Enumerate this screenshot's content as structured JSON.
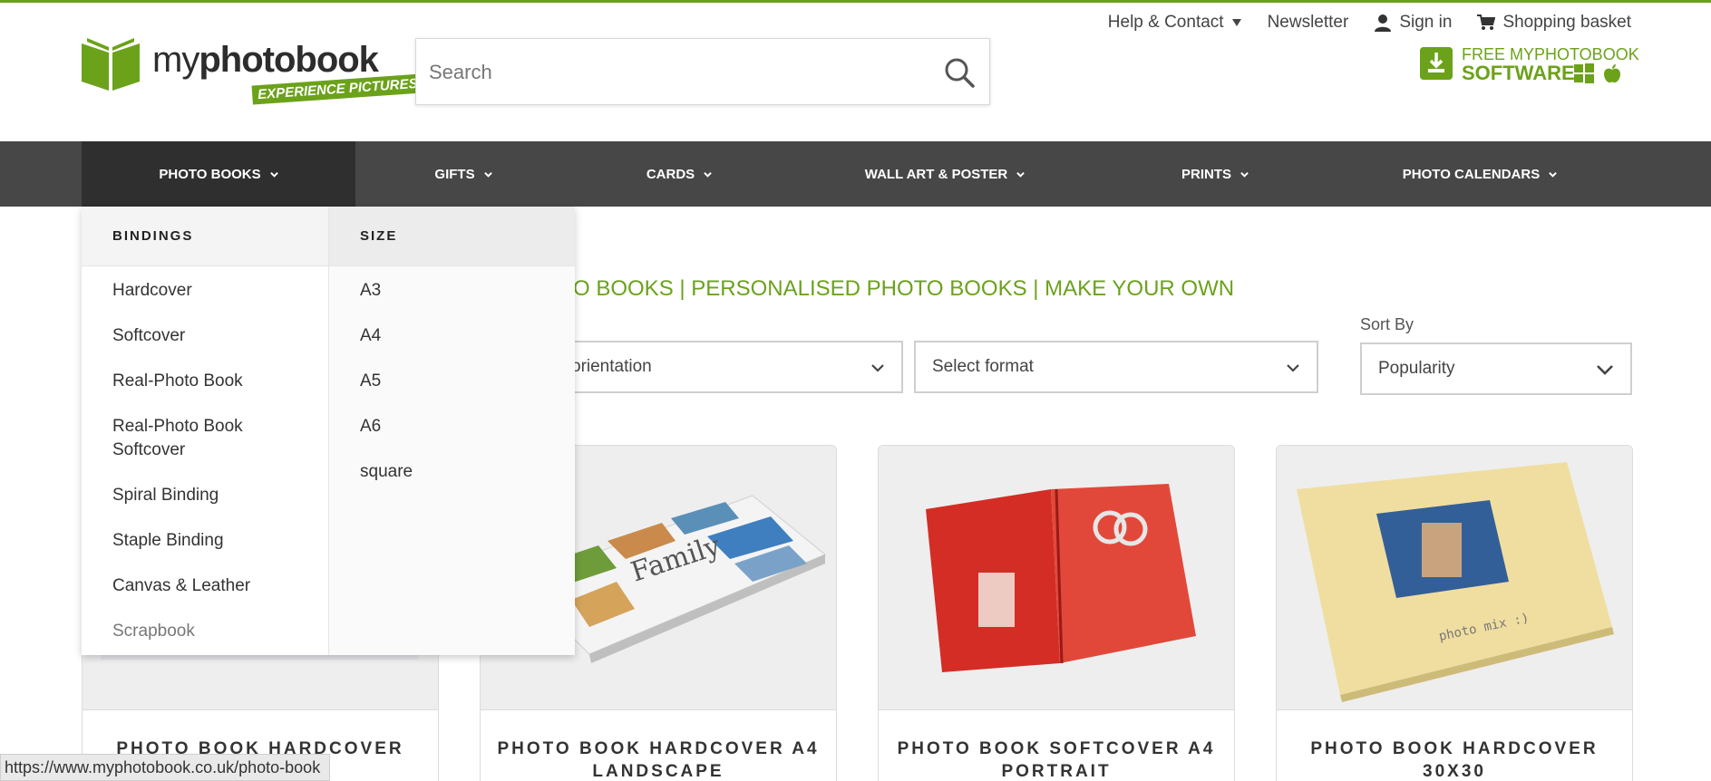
{
  "colors": {
    "brand_green": "#6ba21a",
    "nav_bg": "#474747",
    "nav_active": "#2f2f2f"
  },
  "logo": {
    "prefix": "my",
    "brand_bold": "photobook",
    "tagline": "EXPERIENCE PICTURES"
  },
  "search": {
    "placeholder": "Search"
  },
  "toplinks": {
    "help": "Help & Contact",
    "newsletter": "Newsletter",
    "signin": "Sign in",
    "basket": "Shopping basket"
  },
  "software": {
    "line1": "FREE MYPHOTOBOOK",
    "line2": "SOFTWARE"
  },
  "nav": {
    "items": [
      {
        "label": "PHOTO BOOKS"
      },
      {
        "label": "GIFTS"
      },
      {
        "label": "CARDS"
      },
      {
        "label": "WALL ART & POSTER"
      },
      {
        "label": "PRINTS"
      },
      {
        "label": "PHOTO CALENDARS"
      }
    ]
  },
  "dropdown": {
    "bindings_title": "BINDINGS",
    "bindings": [
      "Hardcover",
      "Softcover",
      "Real-Photo Book",
      "Real-Photo Book Softcover",
      "Spiral Binding",
      "Staple Binding",
      "Canvas & Leather",
      "Scrapbook"
    ],
    "size_title": "SIZE",
    "sizes": [
      "A3",
      "A4",
      "A5",
      "A6",
      "square"
    ]
  },
  "main": {
    "heading_visible": "O BOOKS | PERSONALISED PHOTO BOOKS | MAKE YOUR OWN",
    "filter_orientation": "orientation",
    "filter_format": "Select format",
    "sort_label": "Sort By",
    "sort_value": "Popularity"
  },
  "products": [
    {
      "title": "PHOTO BOOK HARDCOVER"
    },
    {
      "title": "PHOTO BOOK HARDCOVER A4 LANDSCAPE"
    },
    {
      "title": "PHOTO BOOK SOFTCOVER A4 PORTRAIT"
    },
    {
      "title": "PHOTO BOOK HARDCOVER 30X30"
    }
  ],
  "status_url": "https://www.myphotobook.co.uk/photo-book"
}
